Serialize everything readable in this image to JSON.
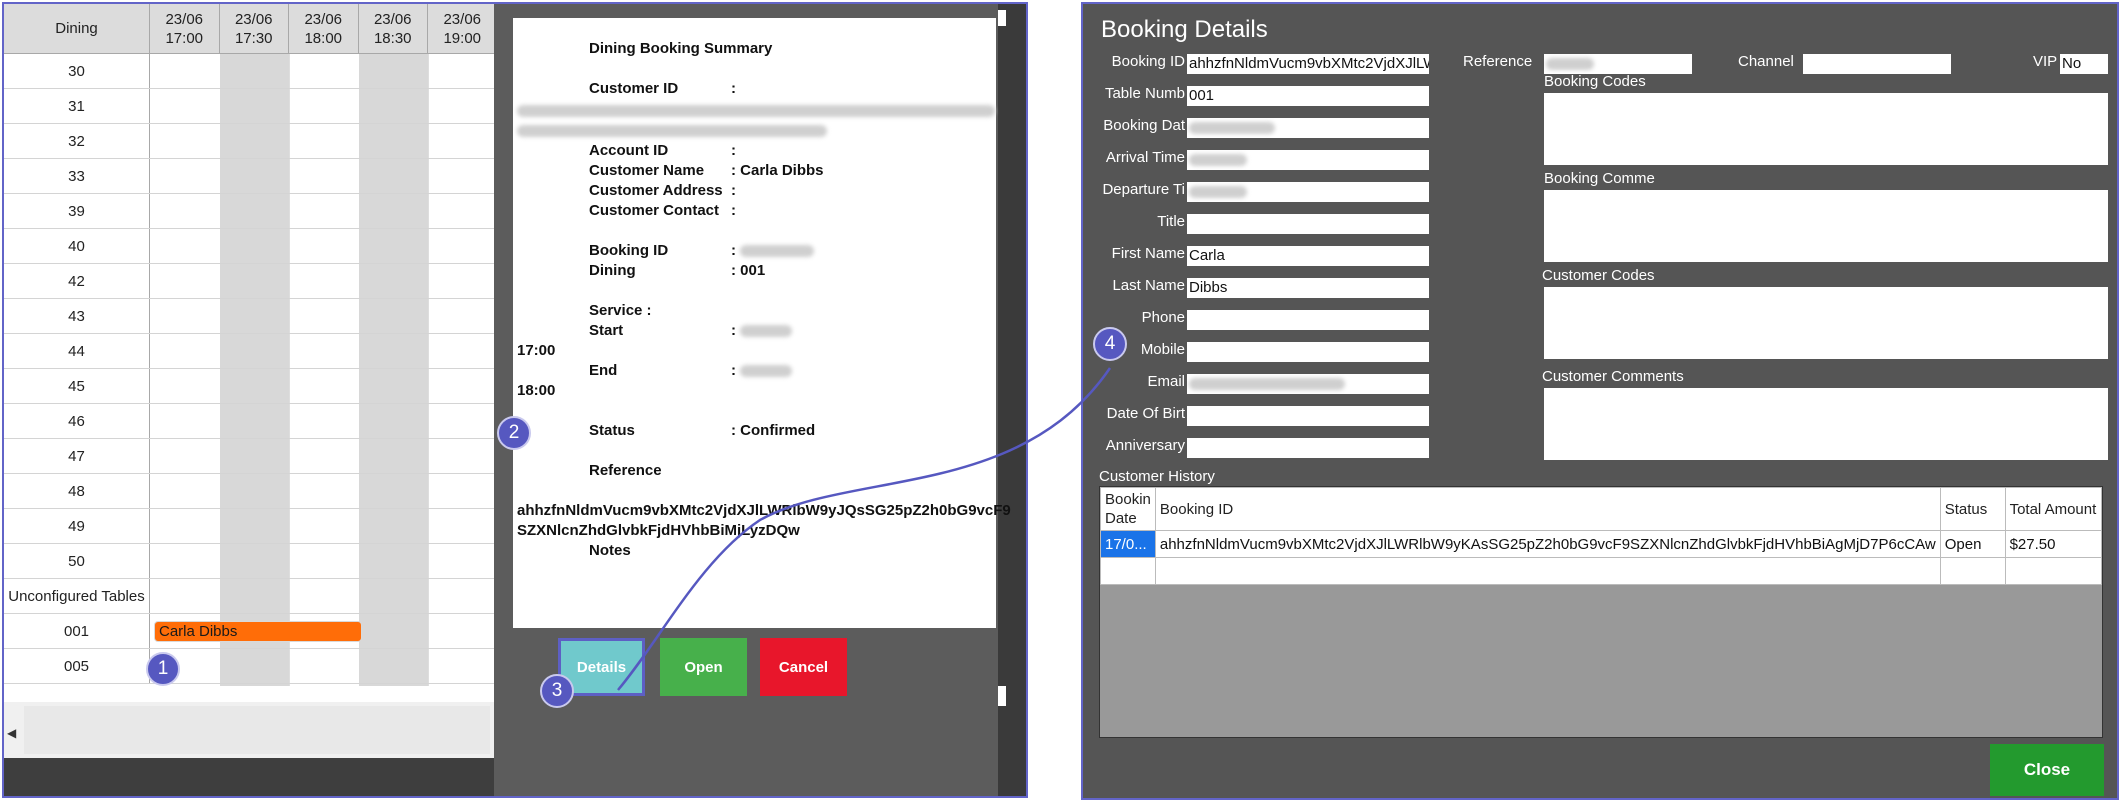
{
  "grid": {
    "corner_header": "Dining",
    "time_columns": [
      {
        "date": "23/06",
        "time": "17:00"
      },
      {
        "date": "23/06",
        "time": "17:30"
      },
      {
        "date": "23/06",
        "time": "18:00"
      },
      {
        "date": "23/06",
        "time": "18:30"
      },
      {
        "date": "23/06",
        "time": "19:00"
      }
    ],
    "tables": [
      "30",
      "31",
      "32",
      "33",
      "39",
      "40",
      "42",
      "43",
      "44",
      "45",
      "46",
      "47",
      "48",
      "49",
      "50",
      "Unconfigured Tables",
      "001",
      "005"
    ],
    "booking_bar_label": "Carla Dibbs"
  },
  "summary": {
    "title": "Dining Booking Summary",
    "customer_id_label": "Customer ID",
    "colon": ":",
    "account_id_label": "Account ID",
    "customer_name_label": "Customer Name",
    "customer_name_value": ": Carla Dibbs",
    "customer_address_label": "Customer Address",
    "customer_contact_label": "Customer Contact",
    "booking_id_label": "Booking ID",
    "dining_label": "Dining",
    "dining_value": ": 001",
    "service_label": "Service    :",
    "start_label": "Start",
    "start_time": "17:00",
    "end_label": "End",
    "end_time": "18:00",
    "status_label": "Status",
    "status_value": ": Confirmed",
    "reference_label": "Reference",
    "reference_line1": "ahhzfnNldmVucm9vbXMtc2VjdXJlLWRlbW9yJQsSG25pZ2h0bG9vcF9",
    "reference_line2": "SZXNlcnZhdGlvbkFjdHVhbBiMjLyzDQw",
    "notes_label": "Notes"
  },
  "buttons": {
    "details": "Details",
    "open": "Open",
    "cancel": "Cancel"
  },
  "markers": [
    "1",
    "2",
    "3",
    "4"
  ],
  "details": {
    "title": "Booking Details",
    "booking_id_label": "Booking ID",
    "booking_id_value": "ahhzfnNldmVucm9vbXMtc2VjdXJlLW",
    "reference_label": "Reference",
    "channel_label": "Channel",
    "vip_label": "VIP",
    "vip_value": "No",
    "table_number_label": "Table Numb",
    "table_number_value": "001",
    "booking_date_label": "Booking Dat",
    "arrival_time_label": "Arrival Time",
    "departure_time_label": "Departure Ti",
    "title_label": "Title",
    "first_name_label": "First Name",
    "first_name_value": "Carla",
    "last_name_label": "Last Name",
    "last_name_value": "Dibbs",
    "phone_label": "Phone",
    "mobile_label": "Mobile",
    "email_label": "Email",
    "dob_label": "Date Of Birt",
    "anniversary_label": "Anniversary",
    "booking_codes_label": "Booking Codes",
    "booking_comments_label": "Booking Comme",
    "customer_codes_label": "Customer Codes",
    "customer_comments_label": "Customer Comments",
    "customer_history_label": "Customer History",
    "history_columns": {
      "booking_date": "Bookin Date",
      "booking_id": "Booking ID",
      "status": "Status",
      "total_amount": "Total Amount"
    },
    "history_rows": [
      {
        "booking_date": "17/0...",
        "booking_id": "ahhzfnNldmVucm9vbXMtc2VjdXJlLWRlbW9yKAsSG25pZ2h0bG9vcF9SZXNlcnZhdGlvbkFjdHVhbBiAgMjD7P6cCAw",
        "status": "Open",
        "total_amount": "$27.50"
      }
    ],
    "close_label": "Close"
  }
}
